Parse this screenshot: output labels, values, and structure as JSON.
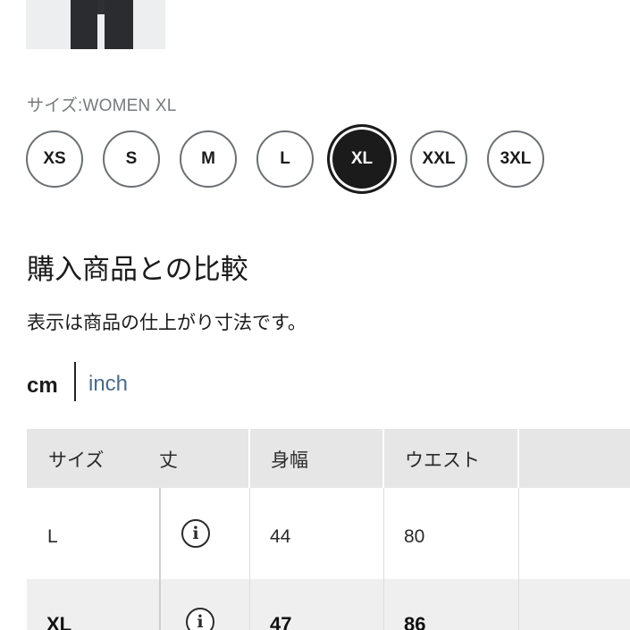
{
  "size_selector": {
    "caption": "サイズ:WOMEN XL",
    "options": [
      "XS",
      "S",
      "M",
      "L",
      "XL",
      "XXL",
      "3XL"
    ],
    "selected": "XL"
  },
  "comparison": {
    "title": "購入商品との比較",
    "note": "表示は商品の仕上がり寸法です。"
  },
  "units": {
    "active": "cm",
    "inactive": "inch"
  },
  "table": {
    "headers": [
      "サイズ",
      "丈",
      "身幅",
      "ウエスト"
    ],
    "rows": [
      {
        "size": "L",
        "width": "44",
        "waist": "80"
      },
      {
        "size": "XL",
        "width": "47",
        "waist": "86"
      }
    ]
  },
  "colors": {
    "selected_bg": "#1b1b1b",
    "link": "#4a6b8a",
    "header_bg": "#e6e6e6"
  }
}
